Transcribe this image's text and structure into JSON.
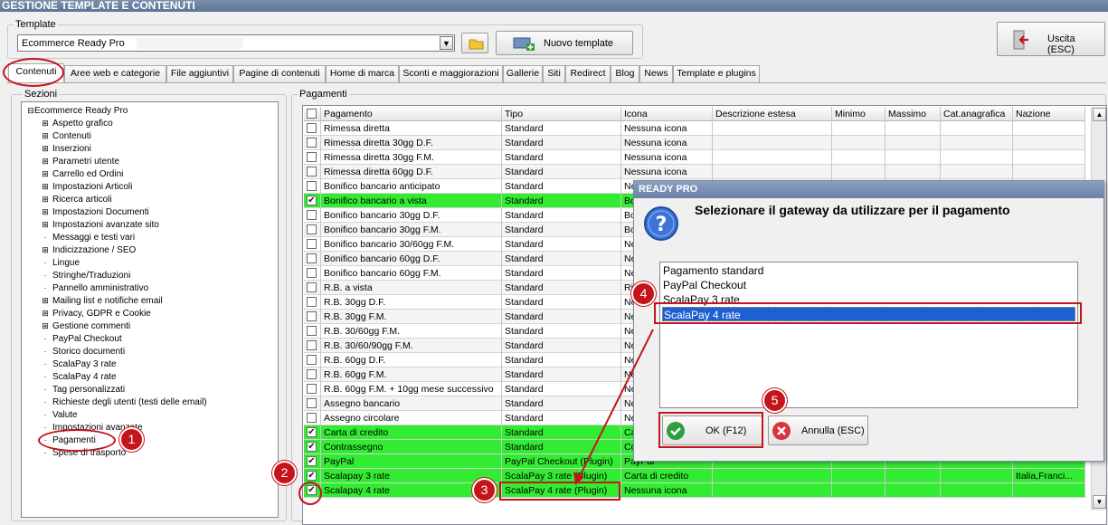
{
  "window": {
    "title": "GESTIONE TEMPLATE E CONTENUTI"
  },
  "template": {
    "group_label": "Template",
    "selected": "Ecommerce Ready Pro",
    "new_template_label": "Nuovo template",
    "exit_label": "Uscita (ESC)"
  },
  "tabs": [
    {
      "label": "Contenuti"
    },
    {
      "label": "Aree web e categorie"
    },
    {
      "label": "File aggiuntivi"
    },
    {
      "label": "Pagine di contenuti"
    },
    {
      "label": "Home di marca"
    },
    {
      "label": "Sconti e maggiorazioni"
    },
    {
      "label": "Gallerie"
    },
    {
      "label": "Siti"
    },
    {
      "label": "Redirect"
    },
    {
      "label": "Blog"
    },
    {
      "label": "News"
    },
    {
      "label": "Template e plugins"
    }
  ],
  "sections": {
    "group_label": "Sezioni",
    "root": "Ecommerce Ready Pro",
    "items": [
      {
        "label": "Aspetto grafico",
        "expandable": true
      },
      {
        "label": "Contenuti",
        "expandable": true
      },
      {
        "label": "Inserzioni",
        "expandable": true
      },
      {
        "label": "Parametri utente",
        "expandable": true
      },
      {
        "label": "Carrello ed Ordini",
        "expandable": true
      },
      {
        "label": "Impostazioni Articoli",
        "expandable": true
      },
      {
        "label": "Ricerca articoli",
        "expandable": true
      },
      {
        "label": "Impostazioni Documenti",
        "expandable": true
      },
      {
        "label": "Impostazioni avanzate sito",
        "expandable": true
      },
      {
        "label": "Messaggi e testi vari",
        "expandable": false
      },
      {
        "label": "Indicizzazione / SEO",
        "expandable": true
      },
      {
        "label": "Lingue",
        "expandable": false
      },
      {
        "label": "Stringhe/Traduzioni",
        "expandable": false
      },
      {
        "label": "Pannello amministrativo",
        "expandable": false
      },
      {
        "label": "Mailing list e notifiche email",
        "expandable": true
      },
      {
        "label": "Privacy, GDPR e Cookie",
        "expandable": true
      },
      {
        "label": "Gestione commenti",
        "expandable": true
      },
      {
        "label": "PayPal Checkout",
        "expandable": false
      },
      {
        "label": "Storico documenti",
        "expandable": false
      },
      {
        "label": "ScalaPay 3 rate",
        "expandable": false
      },
      {
        "label": "ScalaPay 4 rate",
        "expandable": false
      },
      {
        "label": "Tag personalizzati",
        "expandable": false
      },
      {
        "label": "Richieste degli utenti (testi delle email)",
        "expandable": false
      },
      {
        "label": "Valute",
        "expandable": false
      },
      {
        "label": "Impostazioni avanzate",
        "expandable": false
      },
      {
        "label": "Pagamenti",
        "expandable": false
      },
      {
        "label": "Spese di trasporto",
        "expandable": false
      }
    ]
  },
  "payments": {
    "group_label": "Pagamenti",
    "columns": [
      "Pagamento",
      "Tipo",
      "Icona",
      "Descrizione estesa",
      "Minimo",
      "Massimo",
      "Cat.anagrafica",
      "Nazione"
    ],
    "rows": [
      {
        "checked": false,
        "green": false,
        "pagamento": "Rimessa diretta",
        "tipo": "Standard",
        "icona": "Nessuna icona",
        "nazione": ""
      },
      {
        "checked": false,
        "green": false,
        "pagamento": "Rimessa diretta 30gg D.F.",
        "tipo": "Standard",
        "icona": "Nessuna icona",
        "nazione": ""
      },
      {
        "checked": false,
        "green": false,
        "pagamento": "Rimessa diretta 30gg F.M.",
        "tipo": "Standard",
        "icona": "Nessuna icona",
        "nazione": ""
      },
      {
        "checked": false,
        "green": false,
        "pagamento": "Rimessa diretta 60gg D.F.",
        "tipo": "Standard",
        "icona": "Nessuna icona",
        "nazione": ""
      },
      {
        "checked": false,
        "green": false,
        "pagamento": "Bonifico bancario anticipato",
        "tipo": "Standard",
        "icona": "Nessuna icona",
        "nazione": ""
      },
      {
        "checked": true,
        "green": true,
        "pagamento": "Bonifico bancario a vista",
        "tipo": "Standard",
        "icona": "Bo",
        "nazione": ""
      },
      {
        "checked": false,
        "green": false,
        "pagamento": "Bonifico bancario 30gg D.F.",
        "tipo": "Standard",
        "icona": "Bo",
        "nazione": ""
      },
      {
        "checked": false,
        "green": false,
        "pagamento": "Bonifico bancario 30gg F.M.",
        "tipo": "Standard",
        "icona": "Bo",
        "nazione": ""
      },
      {
        "checked": false,
        "green": false,
        "pagamento": "Bonifico bancario 30/60gg F.M.",
        "tipo": "Standard",
        "icona": "Ne",
        "nazione": ""
      },
      {
        "checked": false,
        "green": false,
        "pagamento": "Bonifico bancario 60gg D.F.",
        "tipo": "Standard",
        "icona": "Ne",
        "nazione": ""
      },
      {
        "checked": false,
        "green": false,
        "pagamento": "Bonifico bancario 60gg F.M.",
        "tipo": "Standard",
        "icona": "Ne",
        "nazione": ""
      },
      {
        "checked": false,
        "green": false,
        "pagamento": "R.B. a vista",
        "tipo": "Standard",
        "icona": "Ri",
        "nazione": ""
      },
      {
        "checked": false,
        "green": false,
        "pagamento": "R.B. 30gg D.F.",
        "tipo": "Standard",
        "icona": "Ne",
        "nazione": ""
      },
      {
        "checked": false,
        "green": false,
        "pagamento": "R.B. 30gg F.M.",
        "tipo": "Standard",
        "icona": "Ne",
        "nazione": ""
      },
      {
        "checked": false,
        "green": false,
        "pagamento": "R.B. 30/60gg F.M.",
        "tipo": "Standard",
        "icona": "Ne",
        "nazione": ""
      },
      {
        "checked": false,
        "green": false,
        "pagamento": "R.B. 30/60/90gg F.M.",
        "tipo": "Standard",
        "icona": "Ne",
        "nazione": ""
      },
      {
        "checked": false,
        "green": false,
        "pagamento": "R.B. 60gg D.F.",
        "tipo": "Standard",
        "icona": "Ne",
        "nazione": ""
      },
      {
        "checked": false,
        "green": false,
        "pagamento": "R.B. 60gg F.M.",
        "tipo": "Standard",
        "icona": "Ne",
        "nazione": ""
      },
      {
        "checked": false,
        "green": false,
        "pagamento": "R.B. 60gg F.M. + 10gg mese successivo",
        "tipo": "Standard",
        "icona": "Ne",
        "nazione": ""
      },
      {
        "checked": false,
        "green": false,
        "pagamento": "Assegno bancario",
        "tipo": "Standard",
        "icona": "Ne",
        "nazione": ""
      },
      {
        "checked": false,
        "green": false,
        "pagamento": "Assegno circolare",
        "tipo": "Standard",
        "icona": "Ne",
        "nazione": ""
      },
      {
        "checked": true,
        "green": true,
        "pagamento": "Carta di credito",
        "tipo": "Standard",
        "icona": "Ca",
        "nazione": ""
      },
      {
        "checked": true,
        "green": true,
        "pagamento": "Contrassegno",
        "tipo": "Standard",
        "icona": "Co",
        "nazione": ""
      },
      {
        "checked": true,
        "green": true,
        "pagamento": "PayPal",
        "tipo": "PayPal Checkout (Plugin)",
        "icona": "PayPal",
        "nazione": ""
      },
      {
        "checked": true,
        "green": true,
        "pagamento": "Scalapay 3 rate",
        "tipo": "ScalaPay 3 rate (Plugin)",
        "icona": "Carta di credito",
        "nazione": "Italia,Franci..."
      },
      {
        "checked": true,
        "green": true,
        "pagamento": "Scalapay 4 rate",
        "tipo": "ScalaPay 4 rate (Plugin)",
        "icona": "Nessuna icona",
        "nazione": ""
      }
    ]
  },
  "dialog": {
    "title": "READY PRO",
    "question": "Selezionare il gateway da utilizzare per il pagamento",
    "options": [
      "Pagamento standard",
      "PayPal Checkout",
      "ScalaPay 3 rate",
      "ScalaPay 4 rate"
    ],
    "selected_index": 3,
    "ok_label": "OK (F12)",
    "cancel_label": "Annulla (ESC)"
  },
  "annotations": [
    "1",
    "2",
    "3",
    "4",
    "5"
  ],
  "colors": {
    "highlight_green": "#32ec32",
    "annotation_red": "#c4151c",
    "selection_blue": "#1e5fd1"
  }
}
